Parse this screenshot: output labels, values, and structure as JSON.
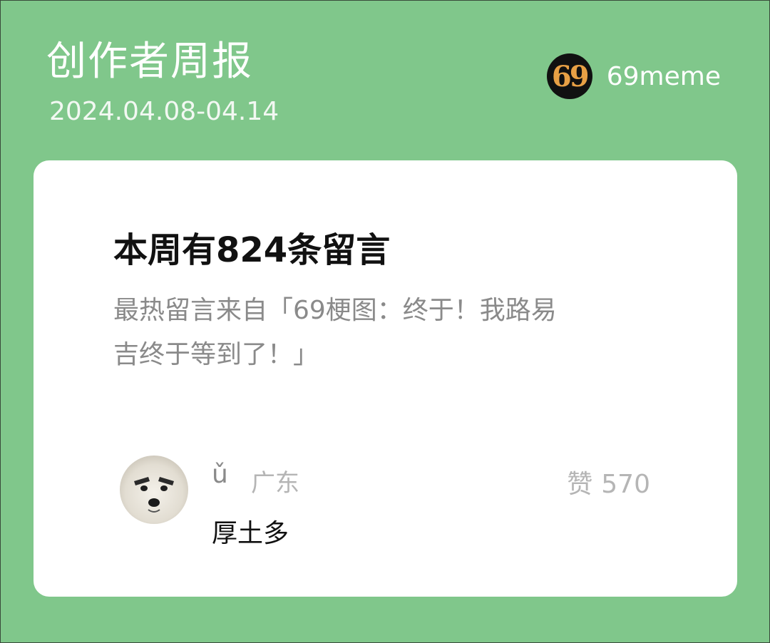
{
  "header": {
    "title": "创作者周报",
    "date_range": "2024.04.08-04.14",
    "account_logo_text": "69",
    "account_name": "69meme"
  },
  "card": {
    "headline": "本周有824条留言",
    "hot_comment_line1": "最热留言来自「69梗图：终于！我路易",
    "hot_comment_line2": "吉终于等到了！」",
    "comment": {
      "username": "ǔ",
      "location": "广东",
      "likes_label": "赞",
      "likes_count": "570",
      "text": "厚土多"
    }
  },
  "colors": {
    "background": "#80c78b",
    "card": "#ffffff",
    "logo_text": "#e8a045"
  }
}
